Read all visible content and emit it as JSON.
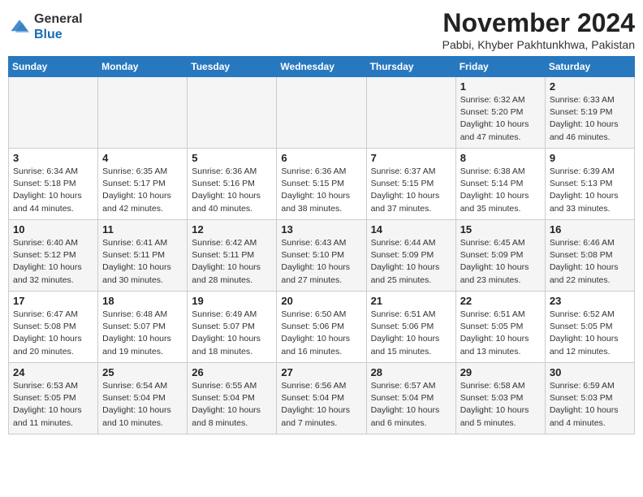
{
  "logo": {
    "line1": "General",
    "line2": "Blue"
  },
  "title": "November 2024",
  "location": "Pabbi, Khyber Pakhtunkhwa, Pakistan",
  "weekdays": [
    "Sunday",
    "Monday",
    "Tuesday",
    "Wednesday",
    "Thursday",
    "Friday",
    "Saturday"
  ],
  "weeks": [
    [
      {
        "day": "",
        "info": ""
      },
      {
        "day": "",
        "info": ""
      },
      {
        "day": "",
        "info": ""
      },
      {
        "day": "",
        "info": ""
      },
      {
        "day": "",
        "info": ""
      },
      {
        "day": "1",
        "info": "Sunrise: 6:32 AM\nSunset: 5:20 PM\nDaylight: 10 hours and 47 minutes."
      },
      {
        "day": "2",
        "info": "Sunrise: 6:33 AM\nSunset: 5:19 PM\nDaylight: 10 hours and 46 minutes."
      }
    ],
    [
      {
        "day": "3",
        "info": "Sunrise: 6:34 AM\nSunset: 5:18 PM\nDaylight: 10 hours and 44 minutes."
      },
      {
        "day": "4",
        "info": "Sunrise: 6:35 AM\nSunset: 5:17 PM\nDaylight: 10 hours and 42 minutes."
      },
      {
        "day": "5",
        "info": "Sunrise: 6:36 AM\nSunset: 5:16 PM\nDaylight: 10 hours and 40 minutes."
      },
      {
        "day": "6",
        "info": "Sunrise: 6:36 AM\nSunset: 5:15 PM\nDaylight: 10 hours and 38 minutes."
      },
      {
        "day": "7",
        "info": "Sunrise: 6:37 AM\nSunset: 5:15 PM\nDaylight: 10 hours and 37 minutes."
      },
      {
        "day": "8",
        "info": "Sunrise: 6:38 AM\nSunset: 5:14 PM\nDaylight: 10 hours and 35 minutes."
      },
      {
        "day": "9",
        "info": "Sunrise: 6:39 AM\nSunset: 5:13 PM\nDaylight: 10 hours and 33 minutes."
      }
    ],
    [
      {
        "day": "10",
        "info": "Sunrise: 6:40 AM\nSunset: 5:12 PM\nDaylight: 10 hours and 32 minutes."
      },
      {
        "day": "11",
        "info": "Sunrise: 6:41 AM\nSunset: 5:11 PM\nDaylight: 10 hours and 30 minutes."
      },
      {
        "day": "12",
        "info": "Sunrise: 6:42 AM\nSunset: 5:11 PM\nDaylight: 10 hours and 28 minutes."
      },
      {
        "day": "13",
        "info": "Sunrise: 6:43 AM\nSunset: 5:10 PM\nDaylight: 10 hours and 27 minutes."
      },
      {
        "day": "14",
        "info": "Sunrise: 6:44 AM\nSunset: 5:09 PM\nDaylight: 10 hours and 25 minutes."
      },
      {
        "day": "15",
        "info": "Sunrise: 6:45 AM\nSunset: 5:09 PM\nDaylight: 10 hours and 23 minutes."
      },
      {
        "day": "16",
        "info": "Sunrise: 6:46 AM\nSunset: 5:08 PM\nDaylight: 10 hours and 22 minutes."
      }
    ],
    [
      {
        "day": "17",
        "info": "Sunrise: 6:47 AM\nSunset: 5:08 PM\nDaylight: 10 hours and 20 minutes."
      },
      {
        "day": "18",
        "info": "Sunrise: 6:48 AM\nSunset: 5:07 PM\nDaylight: 10 hours and 19 minutes."
      },
      {
        "day": "19",
        "info": "Sunrise: 6:49 AM\nSunset: 5:07 PM\nDaylight: 10 hours and 18 minutes."
      },
      {
        "day": "20",
        "info": "Sunrise: 6:50 AM\nSunset: 5:06 PM\nDaylight: 10 hours and 16 minutes."
      },
      {
        "day": "21",
        "info": "Sunrise: 6:51 AM\nSunset: 5:06 PM\nDaylight: 10 hours and 15 minutes."
      },
      {
        "day": "22",
        "info": "Sunrise: 6:51 AM\nSunset: 5:05 PM\nDaylight: 10 hours and 13 minutes."
      },
      {
        "day": "23",
        "info": "Sunrise: 6:52 AM\nSunset: 5:05 PM\nDaylight: 10 hours and 12 minutes."
      }
    ],
    [
      {
        "day": "24",
        "info": "Sunrise: 6:53 AM\nSunset: 5:05 PM\nDaylight: 10 hours and 11 minutes."
      },
      {
        "day": "25",
        "info": "Sunrise: 6:54 AM\nSunset: 5:04 PM\nDaylight: 10 hours and 10 minutes."
      },
      {
        "day": "26",
        "info": "Sunrise: 6:55 AM\nSunset: 5:04 PM\nDaylight: 10 hours and 8 minutes."
      },
      {
        "day": "27",
        "info": "Sunrise: 6:56 AM\nSunset: 5:04 PM\nDaylight: 10 hours and 7 minutes."
      },
      {
        "day": "28",
        "info": "Sunrise: 6:57 AM\nSunset: 5:04 PM\nDaylight: 10 hours and 6 minutes."
      },
      {
        "day": "29",
        "info": "Sunrise: 6:58 AM\nSunset: 5:03 PM\nDaylight: 10 hours and 5 minutes."
      },
      {
        "day": "30",
        "info": "Sunrise: 6:59 AM\nSunset: 5:03 PM\nDaylight: 10 hours and 4 minutes."
      }
    ]
  ]
}
